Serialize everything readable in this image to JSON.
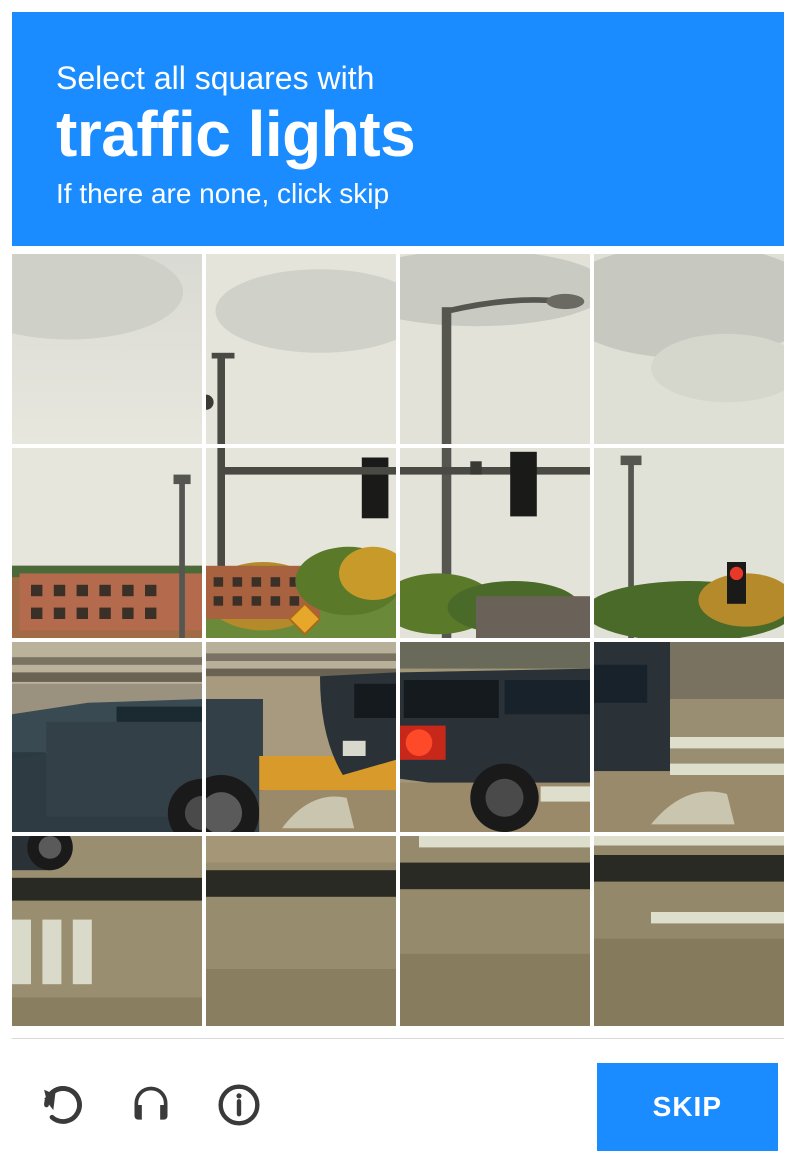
{
  "header": {
    "line1": "Select all squares with",
    "target": "traffic lights",
    "line3": "If there are none, click skip"
  },
  "grid": {
    "rows": 4,
    "cols": 4
  },
  "footer": {
    "reload_label": "Get a new challenge",
    "audio_label": "Get an audio challenge",
    "info_label": "Help",
    "action_label": "SKIP"
  },
  "colors": {
    "accent": "#1a8cff",
    "icon": "#3a3a3a"
  }
}
